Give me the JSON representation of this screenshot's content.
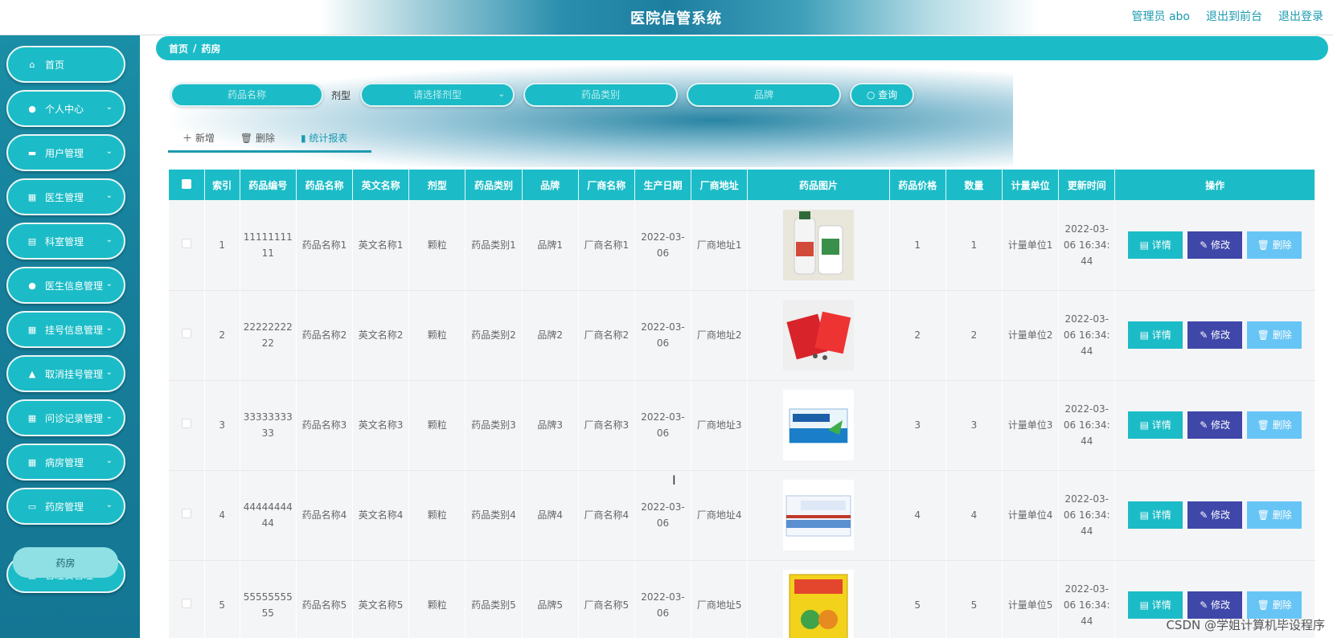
{
  "header": {
    "title": "医院信管系统",
    "links": [
      "管理员 abo",
      "退出到前台",
      "退出登录"
    ]
  },
  "sidebar": {
    "items": [
      {
        "label": "首页",
        "icon": "home-icon",
        "has_submenu": false
      },
      {
        "label": "个人中心",
        "icon": "user-icon",
        "has_submenu": true
      },
      {
        "label": "用户管理",
        "icon": "briefcase-icon",
        "has_submenu": true
      },
      {
        "label": "医生管理",
        "icon": "grid-icon",
        "has_submenu": true
      },
      {
        "label": "科室管理",
        "icon": "clipboard-icon",
        "has_submenu": true
      },
      {
        "label": "医生信息管理",
        "icon": "user-icon",
        "has_submenu": true
      },
      {
        "label": "挂号信息管理",
        "icon": "grid-icon",
        "has_submenu": true
      },
      {
        "label": "取消挂号管理",
        "icon": "thumb-icon",
        "has_submenu": true
      },
      {
        "label": "问诊记录管理",
        "icon": "grid-icon",
        "has_submenu": true
      },
      {
        "label": "病房管理",
        "icon": "grid-icon",
        "has_submenu": true
      },
      {
        "label": "药房管理",
        "icon": "ticket-icon",
        "has_submenu": true
      },
      {
        "label": "管理员管理",
        "icon": "grid-icon",
        "has_submenu": true
      }
    ],
    "active_submenu": "药房"
  },
  "breadcrumb": [
    "首页",
    "/",
    "药房"
  ],
  "search": {
    "drug_name_placeholder": "药品名称",
    "dosage_label": "剂型",
    "dosage_placeholder": "请选择剂型",
    "category_placeholder": "药品类别",
    "brand_placeholder": "品牌",
    "query_label": "查询"
  },
  "toolbar": {
    "add_label": "新增",
    "delete_label": "删除",
    "report_label": "统计报表"
  },
  "table": {
    "columns": [
      "",
      "索引",
      "药品编号",
      "药品名称",
      "英文名称",
      "剂型",
      "药品类别",
      "品牌",
      "厂商名称",
      "生产日期",
      "厂商地址",
      "药品图片",
      "药品价格",
      "数量",
      "计量单位",
      "更新时间",
      "操作"
    ],
    "rows": [
      {
        "index": "1",
        "code": "1111111111",
        "name": "药品名称1",
        "en": "英文名称1",
        "dosage": "颗粒",
        "category": "药品类别1",
        "brand": "品牌1",
        "maker": "厂商名称1",
        "date": "2022-03-06",
        "addr": "厂商地址1",
        "price": "1",
        "qty": "1",
        "unit": "计量单位1",
        "updated": "2022-03-06 16:34:44",
        "image": "bottles"
      },
      {
        "index": "2",
        "code": "2222222222",
        "name": "药品名称2",
        "en": "英文名称2",
        "dosage": "颗粒",
        "category": "药品类别2",
        "brand": "品牌2",
        "maker": "厂商名称2",
        "date": "2022-03-06",
        "addr": "厂商地址2",
        "price": "2",
        "qty": "2",
        "unit": "计量单位2",
        "updated": "2022-03-06 16:34:44",
        "image": "red-box"
      },
      {
        "index": "3",
        "code": "3333333333",
        "name": "药品名称3",
        "en": "英文名称3",
        "dosage": "颗粒",
        "category": "药品类别3",
        "brand": "品牌3",
        "maker": "厂商名称3",
        "date": "2022-03-06",
        "addr": "厂商地址3",
        "price": "3",
        "qty": "3",
        "unit": "计量单位3",
        "updated": "2022-03-06 16:34:44",
        "image": "blue-box"
      },
      {
        "index": "4",
        "code": "4444444444",
        "name": "药品名称4",
        "en": "英文名称4",
        "dosage": "颗粒",
        "category": "药品类别4",
        "brand": "品牌4",
        "maker": "厂商名称4",
        "date": "2022-03-06",
        "addr": "厂商地址4",
        "price": "4",
        "qty": "4",
        "unit": "计量单位4",
        "updated": "2022-03-06 16:34:44",
        "image": "white-box"
      },
      {
        "index": "5",
        "code": "5555555555",
        "name": "药品名称5",
        "en": "英文名称5",
        "dosage": "颗粒",
        "category": "药品类别5",
        "brand": "品牌5",
        "maker": "厂商名称5",
        "date": "2022-03-06",
        "addr": "厂商地址5",
        "price": "5",
        "qty": "5",
        "unit": "计量单位5",
        "updated": "2022-03-06 16:34:44",
        "image": "yellow-box"
      }
    ],
    "actions": {
      "detail": "详情",
      "edit": "修改",
      "delete": "删除"
    }
  },
  "watermark": "CSDN @学姐计算机毕设程序",
  "colors": {
    "primary": "#1bbcc7",
    "edit": "#3f47a9",
    "delete": "#67c5f5",
    "sidebar": "#177f9b"
  }
}
